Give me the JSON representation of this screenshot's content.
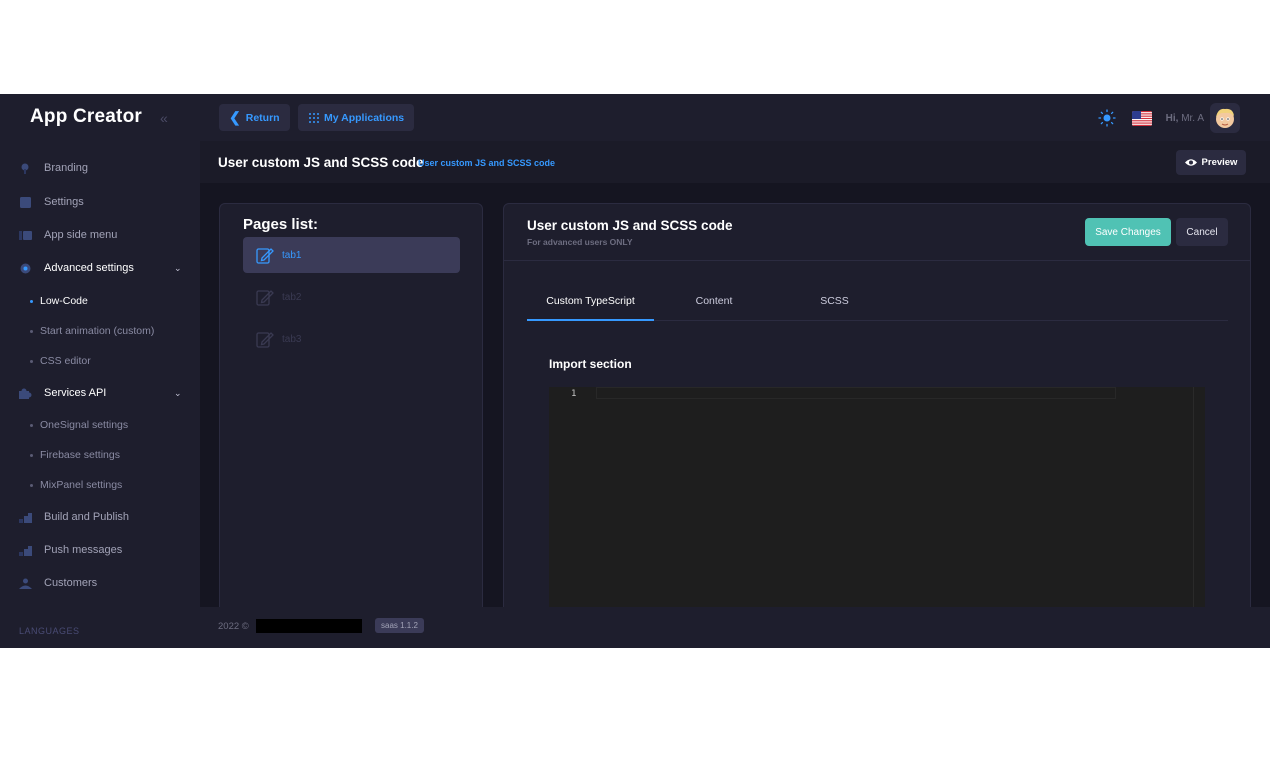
{
  "app": {
    "brand": "App Creator",
    "collapse_icon": "chevron-double-left-icon"
  },
  "sidebar": {
    "items": [
      {
        "label": "Branding",
        "icon": "paint-icon"
      },
      {
        "label": "Settings",
        "icon": "settings-icon"
      },
      {
        "label": "App side menu",
        "icon": "menu-icon"
      },
      {
        "label": "Advanced settings",
        "icon": "gear-icon"
      },
      {
        "label": "Services API",
        "icon": "puzzle-icon"
      },
      {
        "label": "Build and Publish",
        "icon": "chart-icon"
      },
      {
        "label": "Push messages",
        "icon": "chart-icon"
      },
      {
        "label": "Customers",
        "icon": "user-icon"
      }
    ],
    "advanced_sub": [
      {
        "label": "Low-Code"
      },
      {
        "label": "Start animation (custom)"
      },
      {
        "label": "CSS editor"
      }
    ],
    "services_sub": [
      {
        "label": "OneSignal settings"
      },
      {
        "label": "Firebase settings"
      },
      {
        "label": "MixPanel settings"
      }
    ],
    "languages_label": "LANGUAGES"
  },
  "topbar": {
    "return_label": "Return",
    "my_apps_label": "My Applications",
    "greeting": "Hi,",
    "user_name": "Mr. A"
  },
  "subheader": {
    "title": "User custom JS and SCSS code",
    "breadcrumb": "User custom JS and SCSS code",
    "preview_label": "Preview"
  },
  "pages": {
    "title": "Pages list:",
    "items": [
      {
        "label": "tab1"
      },
      {
        "label": "tab2"
      },
      {
        "label": "tab3"
      }
    ]
  },
  "editor": {
    "title": "User custom JS and SCSS code",
    "subtitle": "For advanced users ONLY",
    "save_label": "Save Changes",
    "cancel_label": "Cancel",
    "tabs": [
      {
        "label": "Custom TypeScript"
      },
      {
        "label": "Content"
      },
      {
        "label": "SCSS"
      }
    ],
    "section_title": "Import section",
    "line_number": "1"
  },
  "footer": {
    "copyright": "2022 ©",
    "version": "saas 1.1.2"
  },
  "colors": {
    "accent": "#3699ff",
    "save": "#50c2b4",
    "background": "#1b1b28"
  }
}
